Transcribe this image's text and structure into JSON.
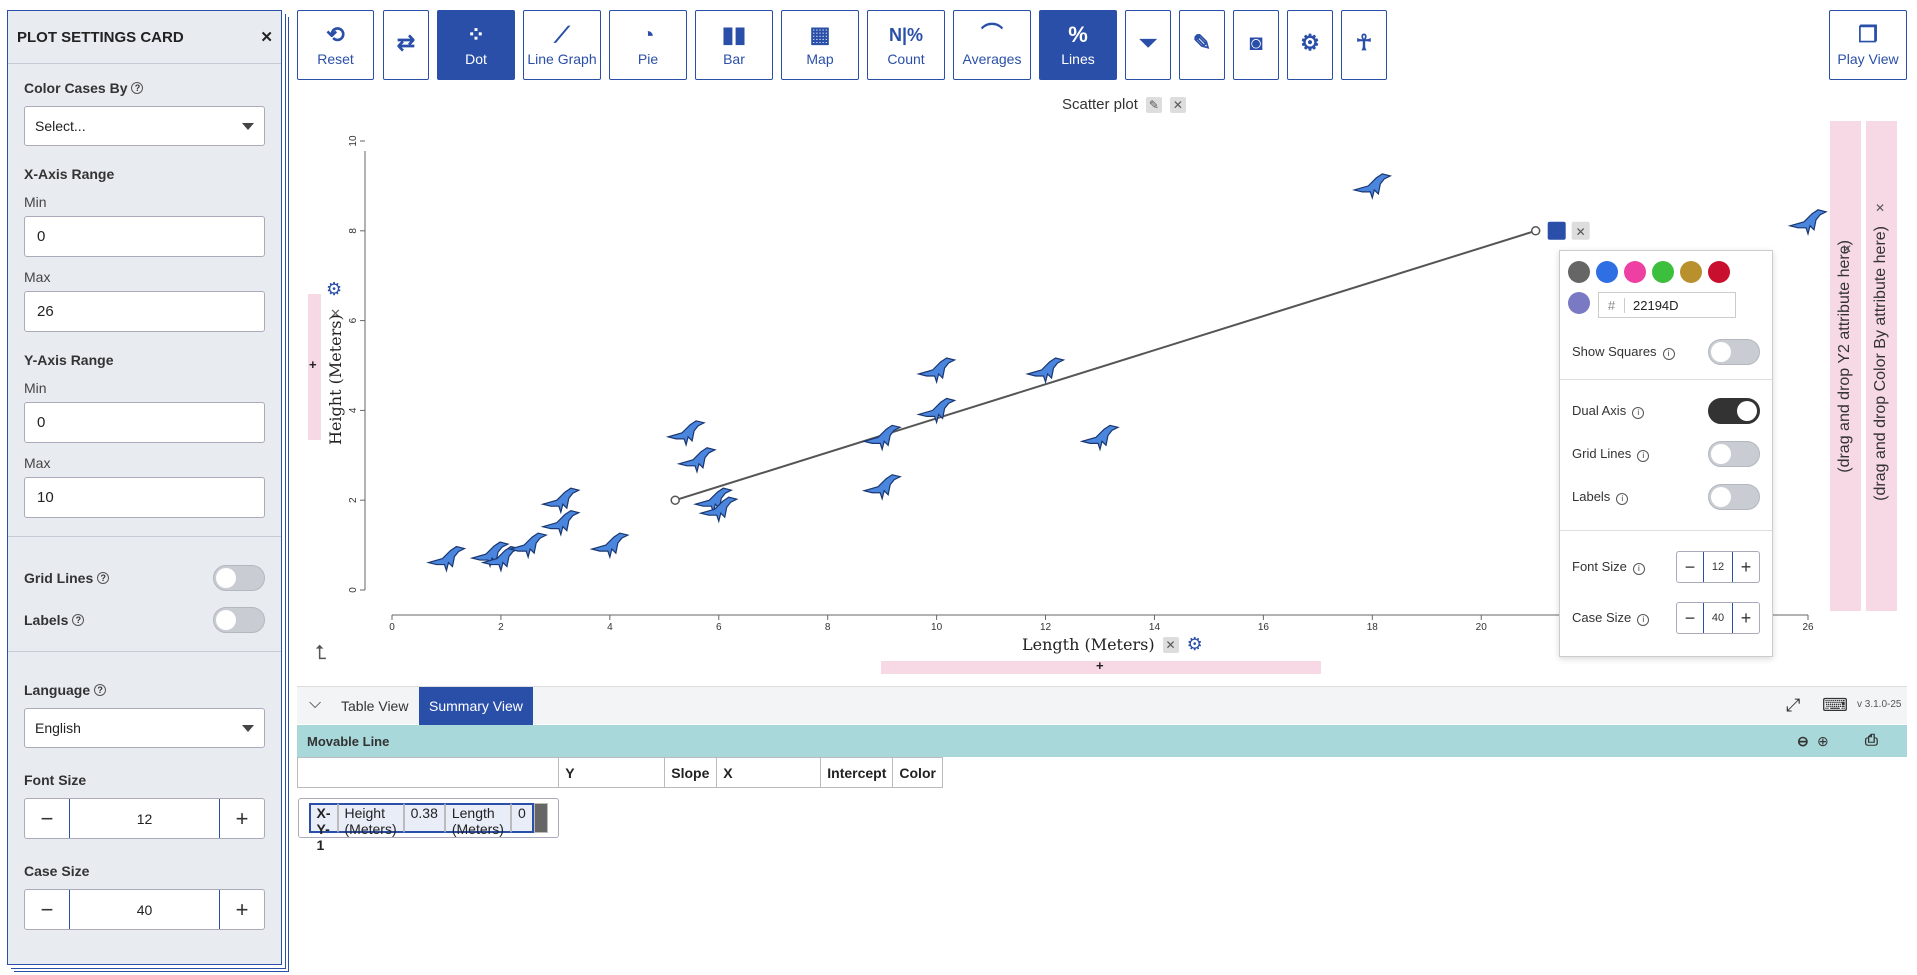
{
  "card": {
    "title": "PLOT SETTINGS CARD",
    "color_cases_by": {
      "label": "Color Cases By",
      "value": "Select..."
    },
    "x_axis_range": {
      "label": "X-Axis Range",
      "min_label": "Min",
      "min": "0",
      "max_label": "Max",
      "max": "26"
    },
    "y_axis_range": {
      "label": "Y-Axis Range",
      "min_label": "Min",
      "min": "0",
      "max_label": "Max",
      "max": "10"
    },
    "grid_lines": {
      "label": "Grid Lines",
      "on": false
    },
    "labels": {
      "label": "Labels",
      "on": false
    },
    "language": {
      "label": "Language",
      "value": "English"
    },
    "font_size": {
      "label": "Font Size",
      "value": "12"
    },
    "case_size": {
      "label": "Case Size",
      "value": "40"
    }
  },
  "toolbar": {
    "reset": "Reset",
    "dot": "Dot",
    "line_graph": "Line Graph",
    "pie": "Pie",
    "bar": "Bar",
    "map": "Map",
    "count": "Count",
    "count_icon": "N|%",
    "averages": "Averages",
    "lines": "Lines",
    "play_view": "Play View"
  },
  "graph": {
    "title": "Scatter plot",
    "xlabel": "Length (Meters)",
    "ylabel": "Height (Meters)",
    "y2_drop": "(drag and drop Y2 attribute here)",
    "color_drop": "(drag and drop Color By attribute here)"
  },
  "chart_data": {
    "type": "scatter",
    "title": "Scatter plot",
    "xlabel": "Length (Meters)",
    "ylabel": "Height (Meters)",
    "xlim": [
      0,
      26
    ],
    "ylim": [
      0,
      10
    ],
    "x_ticks": [
      "0",
      "2",
      "4",
      "6",
      "8",
      "10",
      "12",
      "14",
      "16",
      "18",
      "20",
      "26"
    ],
    "y_ticks": [
      "0",
      "2",
      "4",
      "6",
      "8",
      "10"
    ],
    "points": [
      {
        "x": 1.0,
        "y": 0.7
      },
      {
        "x": 1.8,
        "y": 0.8
      },
      {
        "x": 2.0,
        "y": 0.7
      },
      {
        "x": 2.5,
        "y": 1.0
      },
      {
        "x": 3.1,
        "y": 1.5
      },
      {
        "x": 3.1,
        "y": 2.0
      },
      {
        "x": 4.0,
        "y": 1.0
      },
      {
        "x": 5.4,
        "y": 3.5
      },
      {
        "x": 5.6,
        "y": 2.9
      },
      {
        "x": 5.9,
        "y": 2.0
      },
      {
        "x": 6.0,
        "y": 1.8
      },
      {
        "x": 9.0,
        "y": 3.4
      },
      {
        "x": 9.0,
        "y": 2.3
      },
      {
        "x": 10.0,
        "y": 4.9
      },
      {
        "x": 10.0,
        "y": 4.0
      },
      {
        "x": 12.0,
        "y": 4.9
      },
      {
        "x": 13.0,
        "y": 3.4
      },
      {
        "x": 18.0,
        "y": 9.0
      },
      {
        "x": 26.0,
        "y": 8.2
      }
    ],
    "movable_line": {
      "x1": 5.2,
      "y1": 2.0,
      "x2": 21.0,
      "y2": 8.0
    },
    "grid": false
  },
  "line_popup": {
    "hex": "22194D",
    "swatches": [
      "#666666",
      "#2f6fe4",
      "#ee3fa3",
      "#3cbf3c",
      "#b8902e",
      "#c8102e",
      "#7a7ac4"
    ],
    "show_squares": {
      "label": "Show Squares",
      "on": false
    },
    "dual_axis": {
      "label": "Dual Axis",
      "on": true
    },
    "grid_lines": {
      "label": "Grid Lines",
      "on": false
    },
    "labels": {
      "label": "Labels",
      "on": false
    },
    "font_size": {
      "label": "Font Size",
      "value": "12"
    },
    "case_size": {
      "label": "Case Size",
      "value": "40"
    }
  },
  "bottom": {
    "table_view": "Table View",
    "summary_view": "Summary View",
    "version": "v 3.1.0-25",
    "section": "Movable Line",
    "headers": [
      "",
      "Y",
      "Slope",
      "X",
      "Intercept",
      "Color"
    ],
    "row": {
      "id": "X-Y-1",
      "y": "Height (Meters)",
      "slope": "0.38",
      "x": "Length (Meters)",
      "intercept": "0"
    }
  }
}
